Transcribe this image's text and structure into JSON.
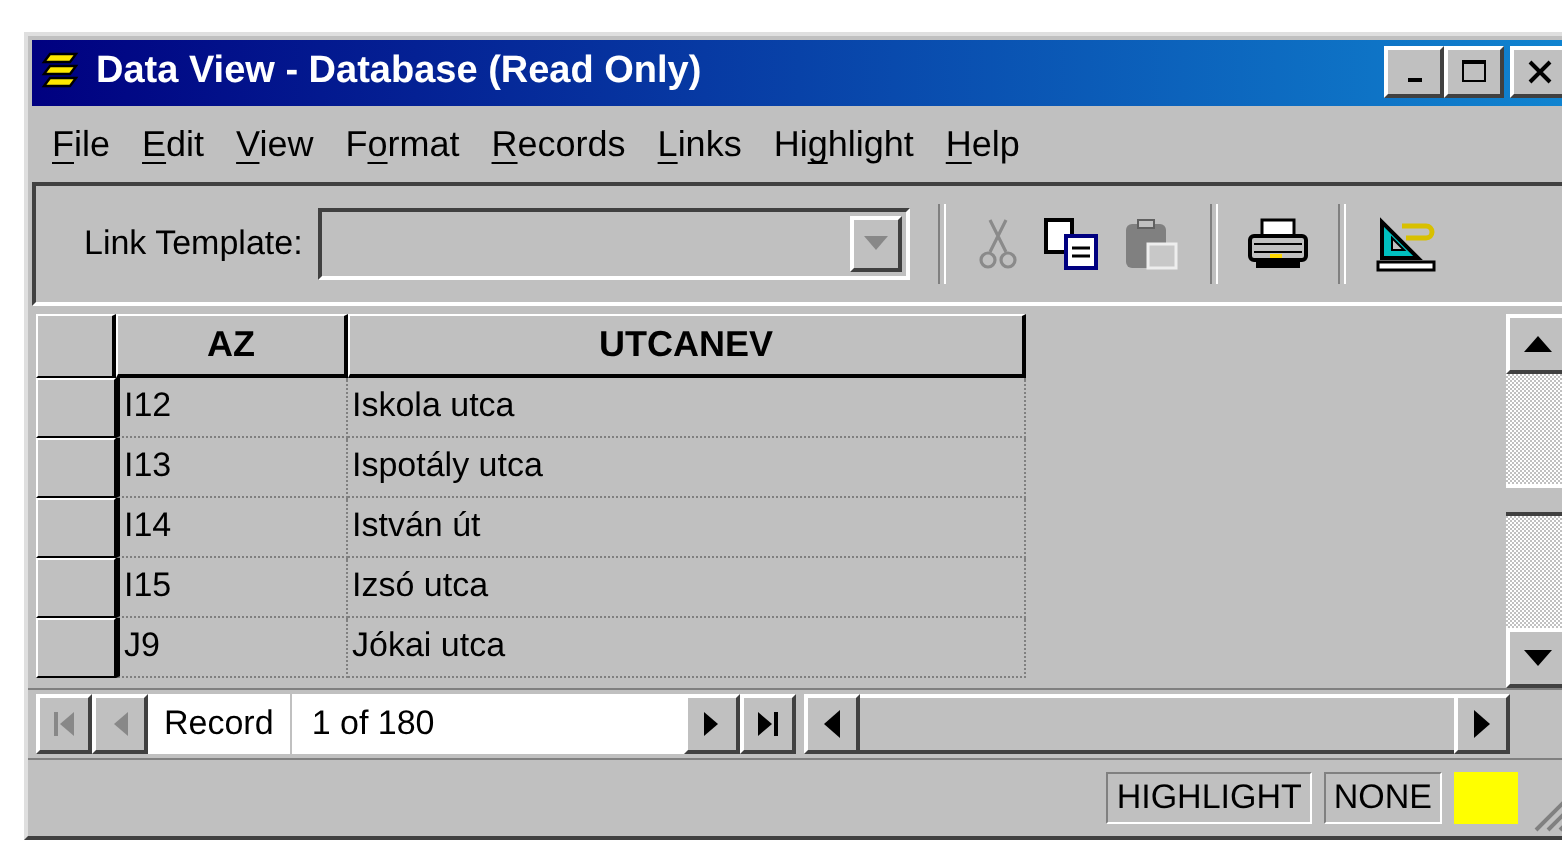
{
  "window": {
    "title": "Data View - Database (Read Only)"
  },
  "menu": [
    {
      "parts": [
        {
          "text": "F",
          "underlined": true
        },
        {
          "text": "ile",
          "underlined": false
        }
      ]
    },
    {
      "parts": [
        {
          "text": "E",
          "underlined": true
        },
        {
          "text": "dit",
          "underlined": false
        }
      ]
    },
    {
      "parts": [
        {
          "text": "V",
          "underlined": true
        },
        {
          "text": "iew",
          "underlined": false
        }
      ]
    },
    {
      "parts": [
        {
          "text": "F",
          "underlined": false
        },
        {
          "text": "o",
          "underlined": true
        },
        {
          "text": "rmat",
          "underlined": false
        }
      ]
    },
    {
      "parts": [
        {
          "text": "R",
          "underlined": true
        },
        {
          "text": "ecords",
          "underlined": false
        }
      ]
    },
    {
      "parts": [
        {
          "text": "L",
          "underlined": true
        },
        {
          "text": "inks",
          "underlined": false
        }
      ]
    },
    {
      "parts": [
        {
          "text": "Hi",
          "underlined": false
        },
        {
          "text": "g",
          "underlined": true
        },
        {
          "text": "hlight",
          "underlined": false
        }
      ]
    },
    {
      "parts": [
        {
          "text": "H",
          "underlined": true
        },
        {
          "text": "elp",
          "underlined": false
        }
      ]
    }
  ],
  "toolbar": {
    "link_template_label": "Link Template:",
    "link_template_disabled": true,
    "tools": [
      {
        "kind": "separator"
      },
      {
        "kind": "cut",
        "disabled": true
      },
      {
        "kind": "copy",
        "disabled": false
      },
      {
        "kind": "paste",
        "disabled": true
      },
      {
        "kind": "separator"
      },
      {
        "kind": "print",
        "disabled": false
      },
      {
        "kind": "separator"
      },
      {
        "kind": "template",
        "disabled": false
      }
    ]
  },
  "table": {
    "columns": [
      "AZ",
      "UTCANEV"
    ],
    "rows": [
      [
        "I12",
        "Iskola utca"
      ],
      [
        "I13",
        "Ispotály utca"
      ],
      [
        "I14",
        "István út"
      ],
      [
        "I15",
        "Izsó utca"
      ],
      [
        "J9",
        "Jókai utca"
      ]
    ]
  },
  "navigator": {
    "label": "Record",
    "position": "1 of 180"
  },
  "status_bar": {
    "mode": "HIGHLIGHT",
    "value": "NONE",
    "color": "#ffff00"
  }
}
